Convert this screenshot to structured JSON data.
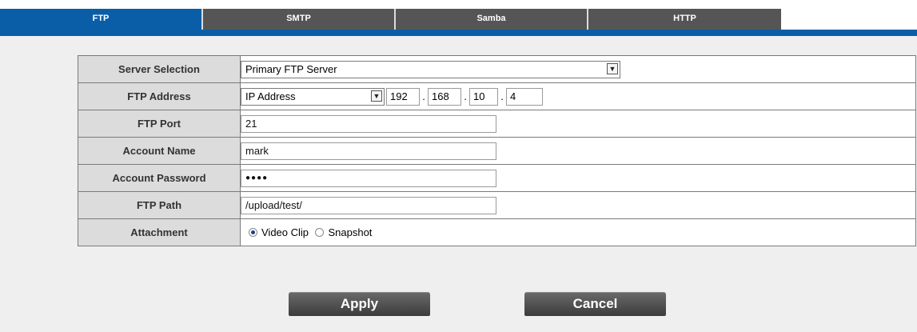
{
  "tabs": [
    {
      "label": "FTP",
      "active": true
    },
    {
      "label": "SMTP",
      "active": false
    },
    {
      "label": "Samba",
      "active": false
    },
    {
      "label": "HTTP",
      "active": false
    }
  ],
  "form": {
    "server_selection": {
      "label": "Server Selection",
      "value": "Primary FTP Server"
    },
    "ftp_address": {
      "label": "FTP Address",
      "type": "IP Address",
      "ip": [
        "192",
        "168",
        "10",
        "4"
      ],
      "separator": "."
    },
    "ftp_port": {
      "label": "FTP Port",
      "value": "21"
    },
    "account_name": {
      "label": "Account Name",
      "value": "mark"
    },
    "account_password": {
      "label": "Account Password",
      "value": "●●●●"
    },
    "ftp_path": {
      "label": "FTP Path",
      "value": "/upload/test/"
    },
    "attachment": {
      "label": "Attachment",
      "options": [
        {
          "label": "Video Clip",
          "checked": true
        },
        {
          "label": "Snapshot",
          "checked": false
        }
      ]
    }
  },
  "buttons": {
    "apply": "Apply",
    "cancel": "Cancel"
  },
  "colors": {
    "accent": "#0a5ea8",
    "tab_inactive": "#555555",
    "panel": "#efefef",
    "label_bg": "#dcdcdc"
  }
}
